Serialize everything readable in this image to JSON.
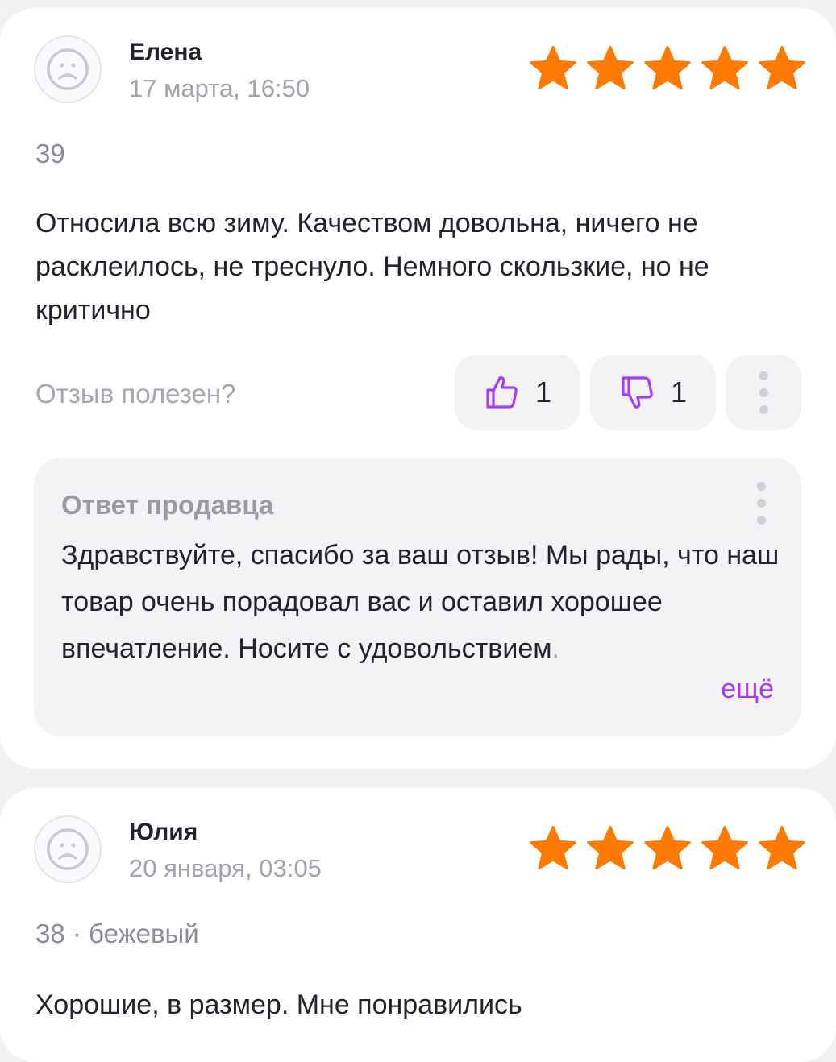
{
  "colors": {
    "star": "#ff7a00",
    "accent": "#a73afd",
    "muted": "#a3a3ad"
  },
  "reviews": [
    {
      "author": "Елена",
      "date": "17 марта, 16:50",
      "rating": 5,
      "meta": "39",
      "text": "Относила всю зиму. Качеством довольна, ничего не расклеилось, не треснуло. Немного скользкие, но не критично",
      "helpful_label": "Отзыв полезен?",
      "likes": "1",
      "dislikes": "1",
      "avatar_icon": "sad-face-icon",
      "seller_reply": {
        "title": "Ответ продавца",
        "text_main": "Здравствуйте, спасибо за ваш отзыв! Мы рады, что наш товар очень порадовал вас и оставил хорошее впечатление. Носите с удовольствие",
        "text_faded": "м.",
        "more_label": "ещё"
      }
    },
    {
      "author": "Юлия",
      "date": "20 января, 03:05",
      "rating": 5,
      "meta": "38 · бежевый",
      "text": "Хорошие, в размер. Мне понравились",
      "avatar_icon": "sad-face-icon"
    }
  ]
}
